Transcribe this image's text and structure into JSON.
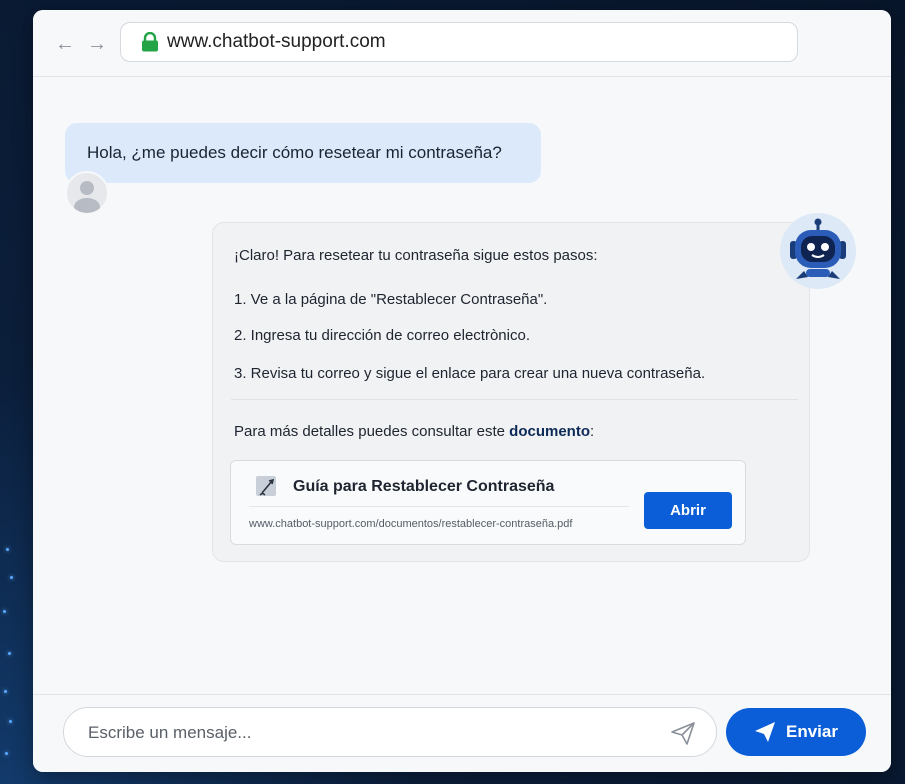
{
  "browser": {
    "url": "www.chatbot-support.com",
    "back_icon": "arrow-left-icon",
    "forward_icon": "arrow-right-icon",
    "lock_icon": "lock-icon"
  },
  "chat": {
    "user_message": "Hola, ¿me puedes decir cómo resetear mi contraseña?",
    "bot": {
      "intro": "¡Claro! Para resetear tu contraseña sigue estos pasos:",
      "steps": [
        "1. Ve a la página de \"Restablecer Contraseña\".",
        "2. Ingresa tu dirección de correo electrònico.",
        "3. Revisa tu correo y sigue el enlace para crear una nueva contraseña."
      ],
      "details_prefix": "Para más detalles puedes consultar este ",
      "details_link": "documento",
      "details_suffix": ":",
      "document": {
        "title": "Guía para Restablecer Contraseña",
        "url": "www.chatbot-support.com/documentos/restablecer-contraseña.pdf",
        "open_label": "Abrir"
      }
    }
  },
  "composer": {
    "placeholder": "Escribe un mensaje...",
    "send_label": "Enviar"
  },
  "colors": {
    "accent": "#0b5ed7",
    "user_bubble": "#dbe9fb",
    "lock": "#22a447"
  }
}
